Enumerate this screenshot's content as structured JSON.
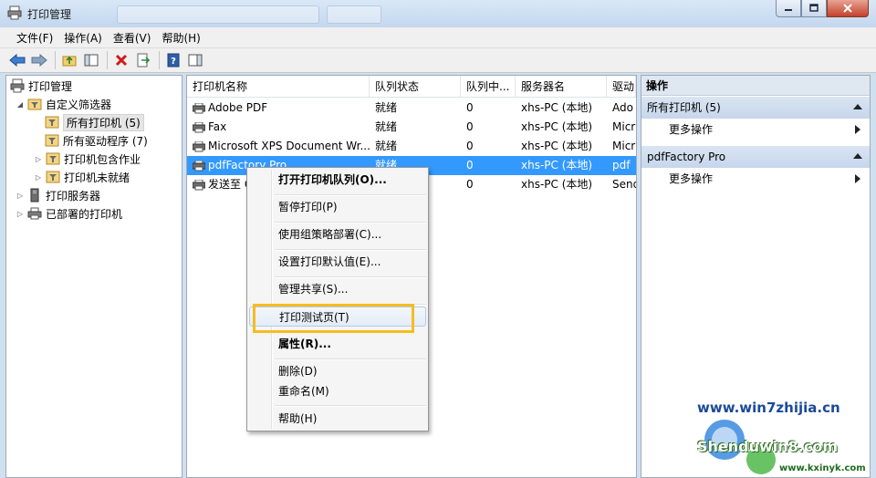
{
  "window": {
    "title": "打印管理"
  },
  "menu": [
    "文件(F)",
    "操作(A)",
    "查看(V)",
    "帮助(H)"
  ],
  "tree": {
    "root": "打印管理",
    "filters": "自定义筛选器",
    "all_printers": "所有打印机 (5)",
    "all_drivers": "所有驱动程序 (7)",
    "printers_with_jobs": "打印机包含作业",
    "printers_not_ready": "打印机未就绪",
    "print_servers": "打印服务器",
    "deployed_printers": "已部署的打印机"
  },
  "table": {
    "columns": [
      "打印机名称",
      "队列状态",
      "队列中...",
      "服务器名",
      "驱动"
    ],
    "rows": [
      {
        "name": "Adobe PDF",
        "status": "就绪",
        "jobs": "0",
        "server": "xhs-PC (本地)",
        "driver": "Ado"
      },
      {
        "name": "Fax",
        "status": "就绪",
        "jobs": "0",
        "server": "xhs-PC (本地)",
        "driver": "Micr"
      },
      {
        "name": "Microsoft XPS Document Wr...",
        "status": "就绪",
        "jobs": "0",
        "server": "xhs-PC (本地)",
        "driver": "Micr"
      },
      {
        "name": "pdfFactory Pro",
        "status": "就绪",
        "jobs": "0",
        "server": "xhs-PC (本地)",
        "driver": "pdf"
      },
      {
        "name": "发送至 O",
        "status": "就绪",
        "jobs": "0",
        "server": "xhs-PC (本地)",
        "driver": "Send"
      }
    ]
  },
  "actions": {
    "title": "操作",
    "section1": "所有打印机 (5)",
    "more1": "更多操作",
    "section2": "pdfFactory Pro",
    "more2": "更多操作"
  },
  "context_menu": {
    "open_queue": "打开打印机队列(O)...",
    "pause": "暂停打印(P)",
    "deploy_gp": "使用组策略部署(C)...",
    "set_defaults": "设置打印默认值(E)...",
    "manage_sharing": "管理共享(S)...",
    "print_test": "打印测试页(T)",
    "properties": "属性(R)...",
    "delete": "删除(D)",
    "rename": "重命名(M)",
    "help": "帮助(H)"
  },
  "watermark": {
    "url1": "www.win7zhijia.cn",
    "brand": "Shenduwin8.com",
    "url2": "www.kxinyk.com"
  },
  "colors": {
    "selection": "#3399ff",
    "highlight_box": "#f5bd1f"
  }
}
